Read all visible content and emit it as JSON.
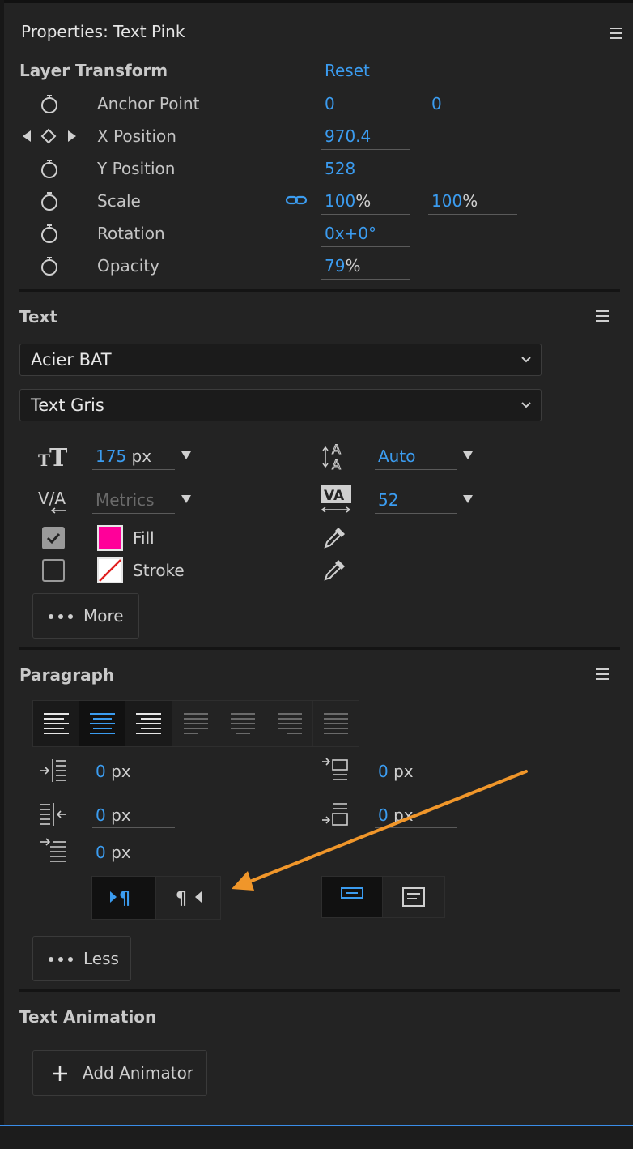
{
  "panel": {
    "title": "Properties: Text Pink"
  },
  "layer_transform": {
    "title": "Layer Transform",
    "reset_label": "Reset",
    "rows": [
      {
        "label": "Anchor Point",
        "v1": "0",
        "v2": "0"
      },
      {
        "label": "X Position",
        "v1": "970.4"
      },
      {
        "label": "Y Position",
        "v1": "528"
      },
      {
        "label": "Scale",
        "v1": "100",
        "u1": "%",
        "v2": "100",
        "u2": "%"
      },
      {
        "label": "Rotation",
        "v1": "0x+0°"
      },
      {
        "label": "Opacity",
        "v1": "79",
        "u1": "%"
      }
    ]
  },
  "text_section": {
    "title": "Text",
    "font_family": "Acier BAT",
    "font_style": "Text Gris",
    "font_size": "175",
    "font_size_unit": "px",
    "leading": "Auto",
    "kerning": "Metrics",
    "tracking": "52",
    "fill_label": "Fill",
    "fill_color": "#ff0099",
    "fill_checked": true,
    "stroke_label": "Stroke",
    "stroke_checked": false,
    "more_label": "More"
  },
  "paragraph": {
    "title": "Paragraph",
    "indent_left": "0",
    "indent_right": "0",
    "indent_first": "0",
    "space_before": "0",
    "space_after": "0",
    "unit": "px",
    "less_label": "Less"
  },
  "text_animation": {
    "title": "Text Animation",
    "add_animator_label": "Add Animator"
  },
  "colors": {
    "accent": "#3b9cf0",
    "annotation_arrow": "#f0962a"
  }
}
